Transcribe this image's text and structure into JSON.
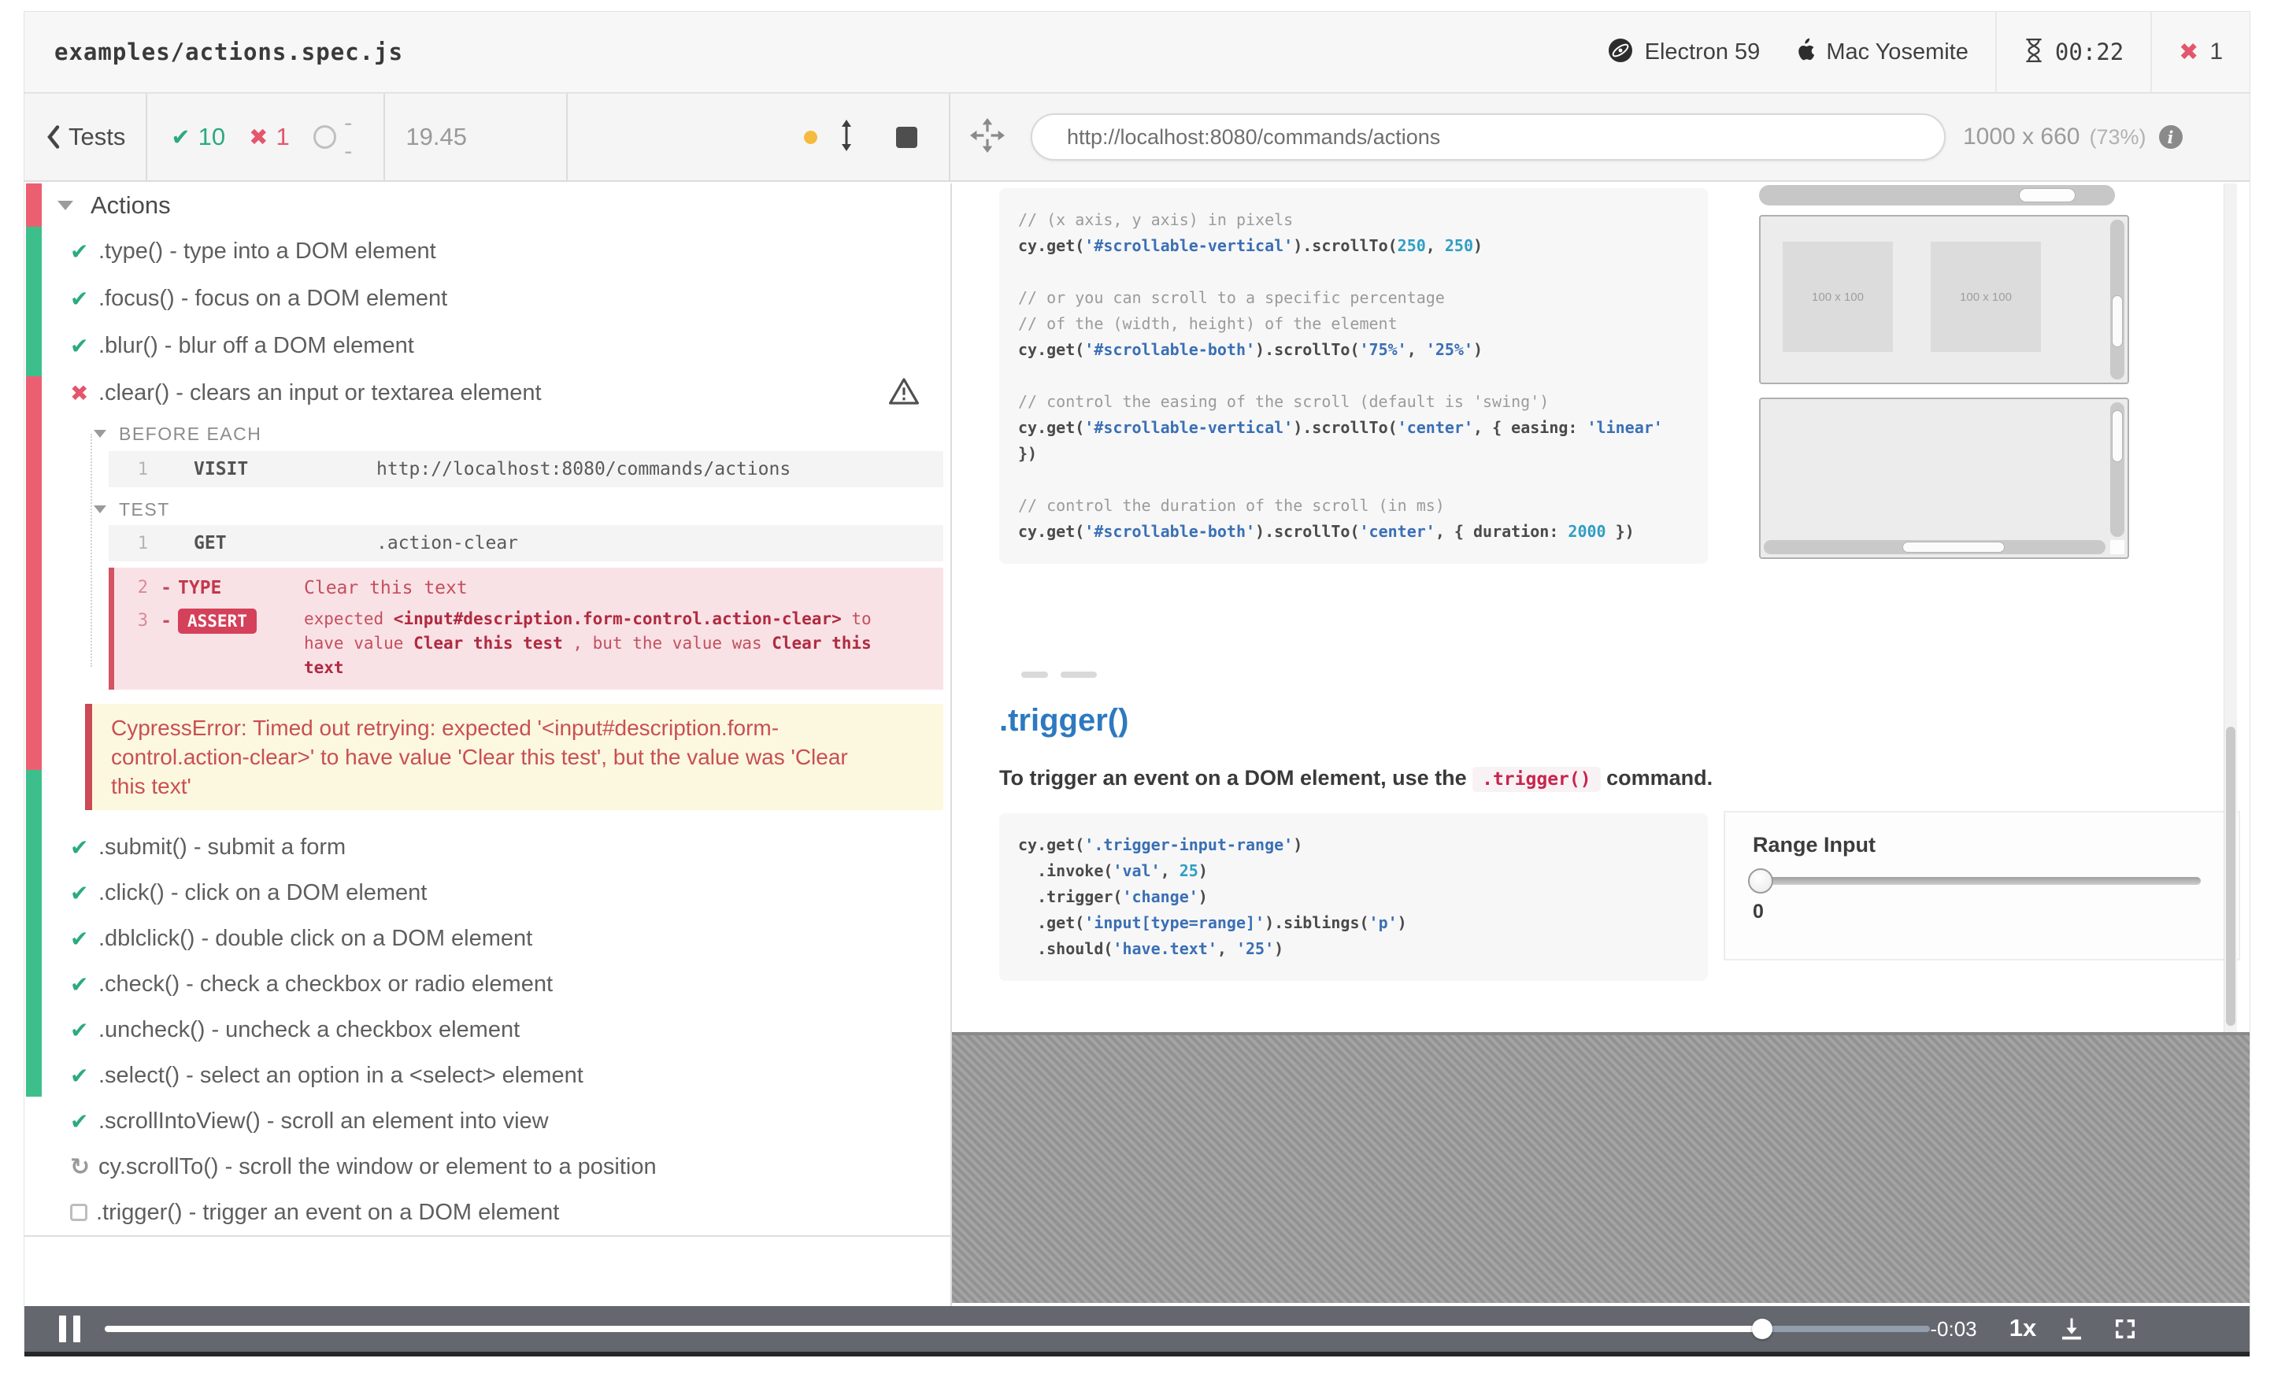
{
  "window": {
    "title": "examples/actions.spec.js"
  },
  "header": {
    "browser_label": "Electron 59",
    "os_label": "Mac Yosemite",
    "timer": "00:22",
    "failed_count": "1"
  },
  "toolbar": {
    "back_label": "Tests",
    "stats": {
      "passed": "10",
      "failed": "1",
      "pending": "--"
    },
    "duration": "19.45",
    "url": "http://localhost:8080/commands/actions",
    "viewport_size": "1000 x 660",
    "viewport_zoom": "(73%)"
  },
  "reporter": {
    "suite_title": "Actions",
    "tests_before": [
      {
        "status": "pass",
        "label": ".type() - type into a DOM element"
      },
      {
        "status": "pass",
        "label": ".focus() - focus on a DOM element"
      },
      {
        "status": "pass",
        "label": ".blur() - blur off a DOM element"
      },
      {
        "status": "fail",
        "label": ".clear() - clears an input or textarea element"
      }
    ],
    "before_each": {
      "title": "BEFORE EACH",
      "num": "1",
      "cmd": "VISIT",
      "args": "http://localhost:8080/commands/actions"
    },
    "test_section": {
      "title": "TEST",
      "num": "1",
      "cmd": "GET",
      "args": ".action-clear"
    },
    "type_row": {
      "num": "2",
      "dash": "-",
      "cmd": "TYPE",
      "args": "Clear this text"
    },
    "assert_row": {
      "num": "3",
      "dash": "-",
      "badge": "ASSERT",
      "message_parts": [
        {
          "c": "pl",
          "t": "expected "
        },
        {
          "c": "bd",
          "t": "<input#description.form-control.action-clear>"
        },
        {
          "c": "pl",
          "t": " to have value "
        },
        {
          "c": "bd",
          "t": "Clear this test"
        },
        {
          "c": "pl",
          "t": " , but the value was "
        },
        {
          "c": "bd",
          "t": "Clear this text"
        }
      ]
    },
    "error_message": "CypressError: Timed out retrying: expected '<input#description.form-control.action-clear>' to have value 'Clear this test', but the value was 'Clear this text'",
    "tests_after": [
      {
        "status": "pass",
        "label": ".submit() - submit a form"
      },
      {
        "status": "pass",
        "label": ".click() - click on a DOM element"
      },
      {
        "status": "pass",
        "label": ".dblclick() - double click on a DOM element"
      },
      {
        "status": "pass",
        "label": ".check() - check a checkbox or radio element"
      },
      {
        "status": "pass",
        "label": ".uncheck() - uncheck a checkbox element"
      },
      {
        "status": "pass",
        "label": ".select() - select an option in a <select> element"
      },
      {
        "status": "pass",
        "label": ".scrollIntoView() - scroll an element into view"
      },
      {
        "status": "running",
        "label": "cy.scrollTo() - scroll the window or element to a position"
      },
      {
        "status": "pending",
        "label": ".trigger() - trigger an event on a DOM element"
      }
    ]
  },
  "aut": {
    "code_block_1": [
      [
        {
          "c": "cm",
          "t": "// (x axis, y axis) in pixels"
        }
      ],
      [
        {
          "c": "pl",
          "t": "cy.get("
        },
        {
          "c": "st",
          "t": "'#scrollable-vertical'"
        },
        {
          "c": "pl",
          "t": ").scrollTo("
        },
        {
          "c": "nu",
          "t": "250"
        },
        {
          "c": "pl",
          "t": ", "
        },
        {
          "c": "nu",
          "t": "250"
        },
        {
          "c": "pl",
          "t": ")"
        }
      ],
      [],
      [
        {
          "c": "cm",
          "t": "// or you can scroll to a specific percentage"
        }
      ],
      [
        {
          "c": "cm",
          "t": "// of the (width, height) of the element"
        }
      ],
      [
        {
          "c": "pl",
          "t": "cy.get("
        },
        {
          "c": "st",
          "t": "'#scrollable-both'"
        },
        {
          "c": "pl",
          "t": ").scrollTo("
        },
        {
          "c": "st",
          "t": "'75%'"
        },
        {
          "c": "pl",
          "t": ", "
        },
        {
          "c": "st",
          "t": "'25%'"
        },
        {
          "c": "pl",
          "t": ")"
        }
      ],
      [],
      [
        {
          "c": "cm",
          "t": "// control the easing of the scroll (default is 'swing')"
        }
      ],
      [
        {
          "c": "pl",
          "t": "cy.get("
        },
        {
          "c": "st",
          "t": "'#scrollable-vertical'"
        },
        {
          "c": "pl",
          "t": ").scrollTo("
        },
        {
          "c": "st",
          "t": "'center'"
        },
        {
          "c": "pl",
          "t": ", { easing: "
        },
        {
          "c": "st",
          "t": "'linear'"
        }
      ],
      [
        {
          "c": "pl",
          "t": "})"
        }
      ],
      [],
      [
        {
          "c": "cm",
          "t": "// control the duration of the scroll (in ms)"
        }
      ],
      [
        {
          "c": "pl",
          "t": "cy.get("
        },
        {
          "c": "st",
          "t": "'#scrollable-both'"
        },
        {
          "c": "pl",
          "t": ").scrollTo("
        },
        {
          "c": "st",
          "t": "'center'"
        },
        {
          "c": "pl",
          "t": ", { duration: "
        },
        {
          "c": "nu",
          "t": "2000"
        },
        {
          "c": "pl",
          "t": " })"
        }
      ]
    ],
    "placeholder_labels": [
      "100 x 100",
      "100 x 100"
    ],
    "trigger_heading": ".trigger()",
    "trigger_desc": {
      "pre": "To trigger an event on a DOM element, use the ",
      "code": ".trigger()",
      "post": " command."
    },
    "code_block_2": [
      [
        {
          "c": "pl",
          "t": "cy.get("
        },
        {
          "c": "st",
          "t": "'.trigger-input-range'"
        },
        {
          "c": "pl",
          "t": ")"
        }
      ],
      [
        {
          "c": "pl",
          "t": "  .invoke("
        },
        {
          "c": "st",
          "t": "'val'"
        },
        {
          "c": "pl",
          "t": ", "
        },
        {
          "c": "nu",
          "t": "25"
        },
        {
          "c": "pl",
          "t": ")"
        }
      ],
      [
        {
          "c": "pl",
          "t": "  .trigger("
        },
        {
          "c": "st",
          "t": "'change'"
        },
        {
          "c": "pl",
          "t": ")"
        }
      ],
      [
        {
          "c": "pl",
          "t": "  .get("
        },
        {
          "c": "st",
          "t": "'input[type=range]'"
        },
        {
          "c": "pl",
          "t": ").siblings("
        },
        {
          "c": "st",
          "t": "'p'"
        },
        {
          "c": "pl",
          "t": ")"
        }
      ],
      [
        {
          "c": "pl",
          "t": "  .should("
        },
        {
          "c": "st",
          "t": "'have.text'"
        },
        {
          "c": "pl",
          "t": ", "
        },
        {
          "c": "st",
          "t": "'25'"
        },
        {
          "c": "pl",
          "t": ")"
        }
      ]
    ],
    "range_input": {
      "label": "Range Input",
      "value": "0"
    }
  },
  "player": {
    "remaining": "-0:03",
    "speed": "1x",
    "progress": 0.908
  },
  "colors": {
    "pass": "#2bab7e",
    "fail": "#e4566c",
    "strip_pass": "#3dbf8c",
    "strip_fail": "#ec5f72",
    "error_bg": "#fcf8e0",
    "error_text": "#c94f53",
    "link_blue": "#2d79c0",
    "accent_yellow": "#f5bb3e"
  }
}
